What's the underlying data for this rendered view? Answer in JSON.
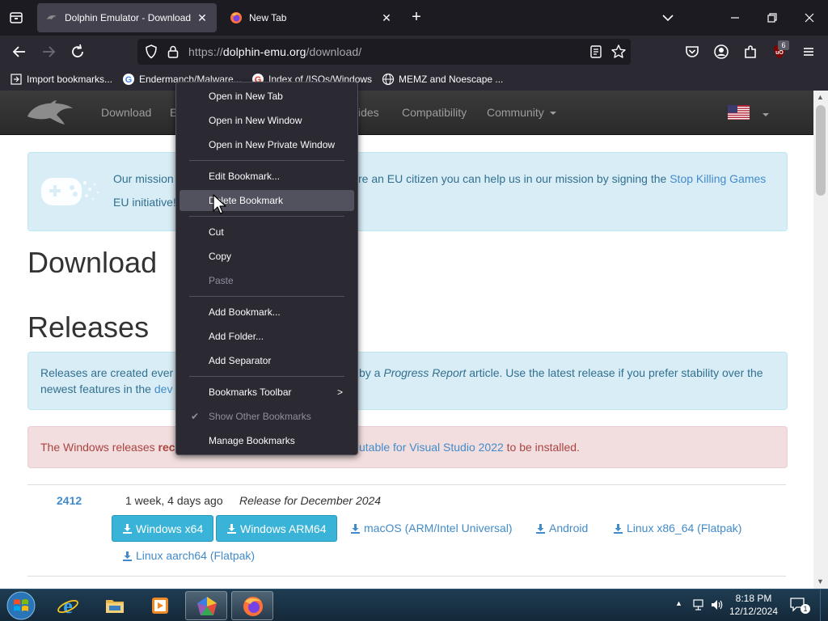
{
  "browser": {
    "tabs": [
      {
        "title": "Dolphin Emulator - Download",
        "active": true
      },
      {
        "title": "New Tab",
        "active": false
      }
    ],
    "url": {
      "prefix": "https://",
      "host": "dolphin-emu.org",
      "path": "/download/"
    },
    "extension_badge": "6",
    "bookmarks": [
      {
        "label": "Import bookmarks..."
      },
      {
        "label": "Endermanch/Malware..."
      },
      {
        "label": "Index of /ISOs/Windows"
      },
      {
        "label": "MEMZ and Noescape ..."
      }
    ]
  },
  "site": {
    "nav": [
      "Download",
      "E",
      "ides",
      "Compatibility",
      "Community"
    ],
    "mission": {
      "start": "Our mission",
      "middle": "re an EU citizen you can help us in our mission by signing the",
      "link": "Stop Killing Games",
      "line2": "EU initiative!"
    },
    "download_heading": "Download",
    "releases_heading": "Releases",
    "releases_info": {
      "line1_start": "Releases are created ever",
      "line1_by": "by a",
      "line1_italic": "Progress Report",
      "line1_end": "article. Use the latest release if you prefer stability over the",
      "line2_start": "newest features in the",
      "line2_link": "dev"
    },
    "windows_alert": {
      "start": "The Windows releases",
      "bold": "rec",
      "link": "utable for Visual Studio 2022",
      "end": "to be installed."
    },
    "release": {
      "version": "2412",
      "date": "1 week, 4 days ago",
      "description": "Release for December 2024",
      "buttons": [
        "Windows x64",
        "Windows ARM64"
      ],
      "links": [
        "macOS (ARM/Intel Universal)",
        "Android",
        "Linux x86_64 (Flatpak)",
        "Linux aarch64 (Flatpak)"
      ]
    }
  },
  "context_menu": {
    "items": [
      {
        "label": "Open in New Tab"
      },
      {
        "label": "Open in New Window"
      },
      {
        "label": "Open in New Private Window"
      },
      {
        "label": "Edit Bookmark..."
      },
      {
        "label": "Delete Bookmark",
        "state": "hovered"
      },
      {
        "label": "Cut"
      },
      {
        "label": "Copy"
      },
      {
        "label": "Paste",
        "state": "disabled"
      },
      {
        "label": "Add Bookmark..."
      },
      {
        "label": "Add Folder..."
      },
      {
        "label": "Add Separator"
      },
      {
        "label": "Bookmarks Toolbar",
        "submenu": true
      },
      {
        "label": "Show Other Bookmarks",
        "state": "disabled",
        "checked": true
      },
      {
        "label": "Manage Bookmarks"
      }
    ]
  },
  "taskbar": {
    "time": "8:18 PM",
    "date": "12/12/2024",
    "notifications": "1"
  },
  "colors": {
    "browser_dark": "#1c1b22",
    "browser_toolbar": "#2b2a33",
    "link": "#428bca",
    "info_bg": "#d9edf7",
    "danger_bg": "#f2dede",
    "button_info": "#39b3d7"
  },
  "icons": [
    "list-all-tabs-icon",
    "dolphin-favicon-icon",
    "firefox-icon",
    "back-icon",
    "forward-icon",
    "reload-icon",
    "shield-icon",
    "lock-icon",
    "reader-view-icon",
    "star-icon",
    "pocket-icon",
    "account-icon",
    "extensions-icon",
    "ublock-icon",
    "menu-icon",
    "import-icon",
    "google-icon",
    "globe-icon",
    "download-icon",
    "windows-start-icon",
    "ie-icon",
    "explorer-icon",
    "media-player-icon",
    "mouse-cursor-icon"
  ]
}
